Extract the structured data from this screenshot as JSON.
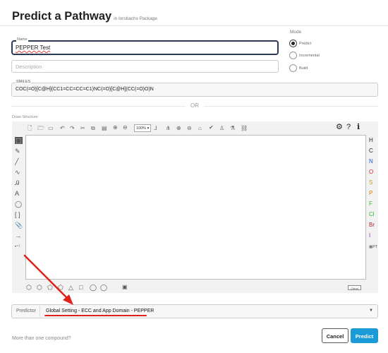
{
  "header": {
    "title": "Predict a Pathway",
    "subtitle": "in lorsbachs Package"
  },
  "name_field": {
    "label": "Name",
    "value": "PEPPER Test"
  },
  "description_field": {
    "placeholder": "Description"
  },
  "mode": {
    "title": "Mode",
    "options": [
      {
        "label": "Predict",
        "selected": true
      },
      {
        "label": "Incremental",
        "selected": false
      },
      {
        "label": "Build",
        "selected": false
      }
    ]
  },
  "smiles_field": {
    "label": "SMILES",
    "value": "COC(=O)[C@H](CC1=CC=CC=C1)NC(=O)[C@H](CC(=O)O)N"
  },
  "divider": {
    "text": "OR"
  },
  "draw": {
    "label": "Draw Structure",
    "zoom": "100%",
    "elements": [
      "H",
      "C",
      "N",
      "O",
      "S",
      "P",
      "F",
      "Cl",
      "Br",
      "I"
    ],
    "element_colors": {
      "H": "#222222",
      "C": "#222222",
      "N": "#2255dd",
      "O": "#dd2222",
      "S": "#c8a020",
      "P": "#e07a10",
      "F": "#33bb33",
      "Cl": "#33bb33",
      "Br": "#a52a2a",
      "I": "#8a2be2"
    },
    "periodic_table": "PT",
    "chiral_label": "Chiral"
  },
  "predictor": {
    "label": "Predictor",
    "value": "Global Setting - ECC and App Domain - PEPPER"
  },
  "footer": {
    "more_text": "More than one compound?",
    "cancel": "Cancel",
    "predict": "Predict"
  },
  "colors": {
    "accent": "#1a9bd7",
    "annotation": "#e0211b",
    "focus_border": "#2b3a55"
  }
}
